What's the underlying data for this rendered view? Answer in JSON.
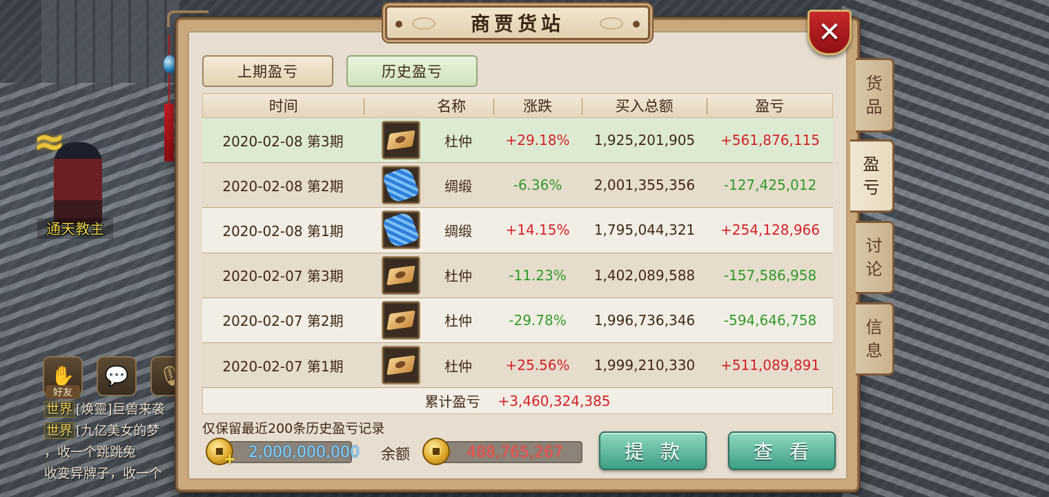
{
  "window": {
    "title": "商贾货站"
  },
  "subtabs": [
    {
      "label": "上期盈亏",
      "active": false
    },
    {
      "label": "历史盈亏",
      "active": true
    }
  ],
  "sidetabs": [
    {
      "label": [
        "货",
        "品"
      ],
      "active": false
    },
    {
      "label": [
        "盈",
        "亏"
      ],
      "active": true
    },
    {
      "label": [
        "讨",
        "论"
      ],
      "active": false
    },
    {
      "label": [
        "信",
        "息"
      ],
      "active": false
    }
  ],
  "table": {
    "headers": {
      "time": "时间",
      "name": "名称",
      "change": "涨跌",
      "buy_total": "买入总额",
      "profit": "盈亏"
    },
    "rows": [
      {
        "time": "2020-02-08 第3期",
        "icon": "herb-icon",
        "name": "杜仲",
        "change": "+29.18%",
        "buy_total": "1,925,201,905",
        "profit": "+561,876,115"
      },
      {
        "time": "2020-02-08 第2期",
        "icon": "silk-icon",
        "name": "绸缎",
        "change": "-6.36%",
        "buy_total": "2,001,355,356",
        "profit": "-127,425,012"
      },
      {
        "time": "2020-02-08 第1期",
        "icon": "silk-icon",
        "name": "绸缎",
        "change": "+14.15%",
        "buy_total": "1,795,044,321",
        "profit": "+254,128,966"
      },
      {
        "time": "2020-02-07 第3期",
        "icon": "herb-icon",
        "name": "杜仲",
        "change": "-11.23%",
        "buy_total": "1,402,089,588",
        "profit": "-157,586,958"
      },
      {
        "time": "2020-02-07 第2期",
        "icon": "herb-icon",
        "name": "杜仲",
        "change": "-29.78%",
        "buy_total": "1,996,736,346",
        "profit": "-594,646,758"
      },
      {
        "time": "2020-02-07 第1期",
        "icon": "herb-icon",
        "name": "杜仲",
        "change": "+25.56%",
        "buy_total": "1,999,210,330",
        "profit": "+511,089,891"
      }
    ],
    "total_label": "累计盈亏",
    "total_value": "+3,460,324,385"
  },
  "note": "仅保留最近200条历史盈亏记录",
  "funds": {
    "currency_value": "2,000,000,000",
    "balance_label": "余额",
    "balance_value": "488,765,267"
  },
  "buttons": {
    "withdraw": "提款",
    "view": "查看"
  },
  "scene": {
    "npc_name": "通天教主",
    "social": [
      {
        "icon": "handshake-icon",
        "label": "好友"
      },
      {
        "icon": "chat-bubble-icon",
        "label": ""
      },
      {
        "icon": "microphone-icon",
        "label": ""
      }
    ],
    "chat": [
      {
        "channel": "世界",
        "text": "[焕靈]巨兽来袭"
      },
      {
        "channel": "世界",
        "text": "[九亿美女的梦"
      },
      {
        "channel": "",
        "text": "，收一个跳跳兔"
      },
      {
        "channel": "",
        "text": "收变异牌子，收一个"
      }
    ]
  },
  "colors": {
    "positive": "#d3202a",
    "negative": "#2f9a2a",
    "accent": "#3e9e86"
  }
}
